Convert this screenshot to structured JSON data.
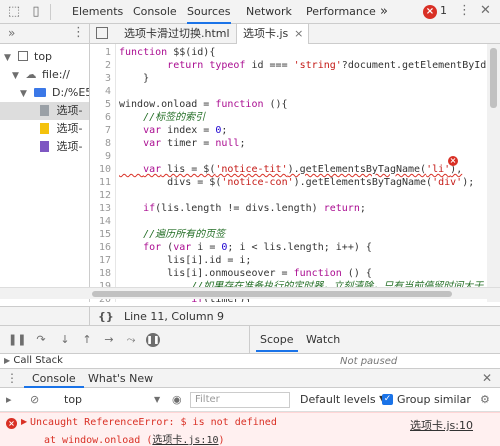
{
  "toolbar": {
    "tabs": [
      "Elements",
      "Console",
      "Sources",
      "Network",
      "Performance"
    ],
    "active_tab": "Sources",
    "more": "»",
    "error_count": "1"
  },
  "navigator": {
    "more": "»",
    "top": "top",
    "file_origin": "file://",
    "folder": "D:/%E5",
    "files": [
      "选项-",
      "选项-",
      "选项-"
    ]
  },
  "editor": {
    "tabs": [
      "选项卡滑过切换.html",
      "选项卡.js"
    ],
    "line_numbers": [
      "1",
      "2",
      "3",
      "4",
      "5",
      "6",
      "7",
      "8",
      "9",
      "10",
      "11",
      "12",
      "13",
      "14",
      "15",
      "16",
      "17",
      "18",
      "19",
      "20",
      "21"
    ],
    "lines": [
      "function $$(id){",
      "        return typeof id === 'string'?document.getElementById('i",
      "    }",
      "",
      "window.onload = function (){",
      "    //标签的索引",
      "    var index = 0;",
      "    var timer = null;",
      "",
      "    var lis = $('notice-tit').getElementsByTagName('li'),",
      "        divs = $('notice-con').getElementsByTagName('div');",
      "",
      "    if(lis.length != divs.length) return;",
      "",
      "    //遍历所有的页签",
      "    for (var i = 0; i < lis.length; i++) {",
      "        lis[i].id = i;",
      "        lis[i].onmouseover = function () {",
      "            //如果存在准备执行的定时器，立刻清除，只有当前停留时间大于",
      "            if(timer){",
      "                "
    ]
  },
  "status": {
    "braces": "{}",
    "position": "Line 11, Column 9"
  },
  "debugger": {
    "scope_tabs": [
      "Scope",
      "Watch"
    ],
    "call_stack": "Call Stack",
    "not_paused": "Not paused"
  },
  "drawer": {
    "tabs": [
      "Console",
      "What's New"
    ],
    "context": "top",
    "filter_placeholder": "Filter",
    "levels": "Default levels ▼",
    "group_similar": "Group similar"
  },
  "error": {
    "message": "Uncaught ReferenceError: $ is not defined",
    "at_prefix": "at window.onload (",
    "at_link": "选项卡.js:10",
    "at_suffix": ")",
    "source": "选项卡.js:10"
  }
}
